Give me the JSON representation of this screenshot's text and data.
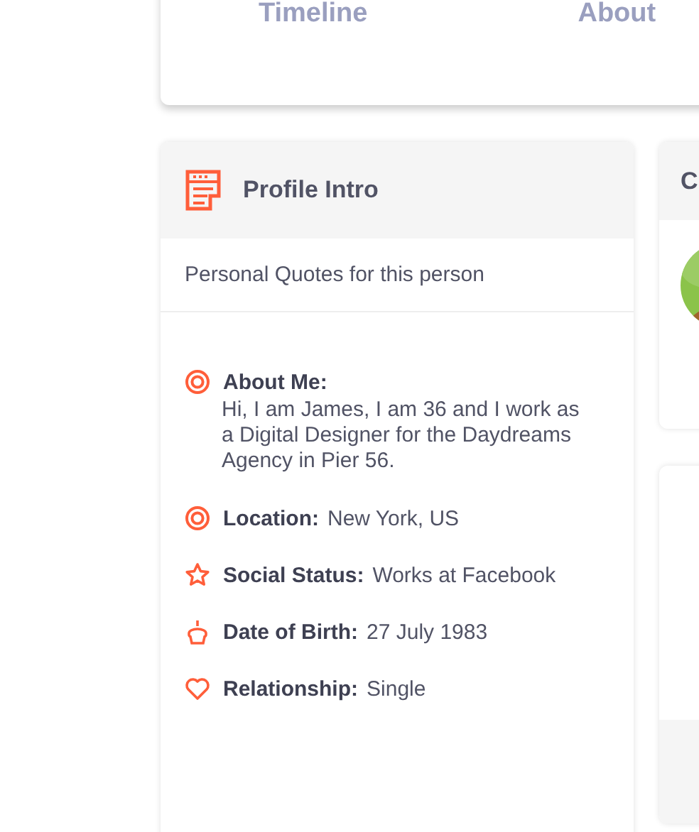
{
  "tabs": [
    {
      "label": "Timeline"
    },
    {
      "label": "About"
    }
  ],
  "profile_intro": {
    "title": "Profile Intro",
    "subtitle": "Personal Quotes for this person",
    "items": [
      {
        "kind": "target",
        "label": "About Me:",
        "value": "Hi, I am James, I am 36 and I work as a Digital Designer for the Daydreams Agency in Pier 56.",
        "block": true
      },
      {
        "kind": "target",
        "label": "Location:",
        "value": "New York, US",
        "block": false
      },
      {
        "kind": "star",
        "label": "Social Status:",
        "value": "Works at Facebook",
        "block": false
      },
      {
        "kind": "cake",
        "label": "Date of Birth:",
        "value": "27 July 1983",
        "block": false
      },
      {
        "kind": "heart",
        "label": "Relationship:",
        "value": "Single",
        "block": false
      }
    ]
  },
  "side_card": {
    "title": "C"
  }
}
